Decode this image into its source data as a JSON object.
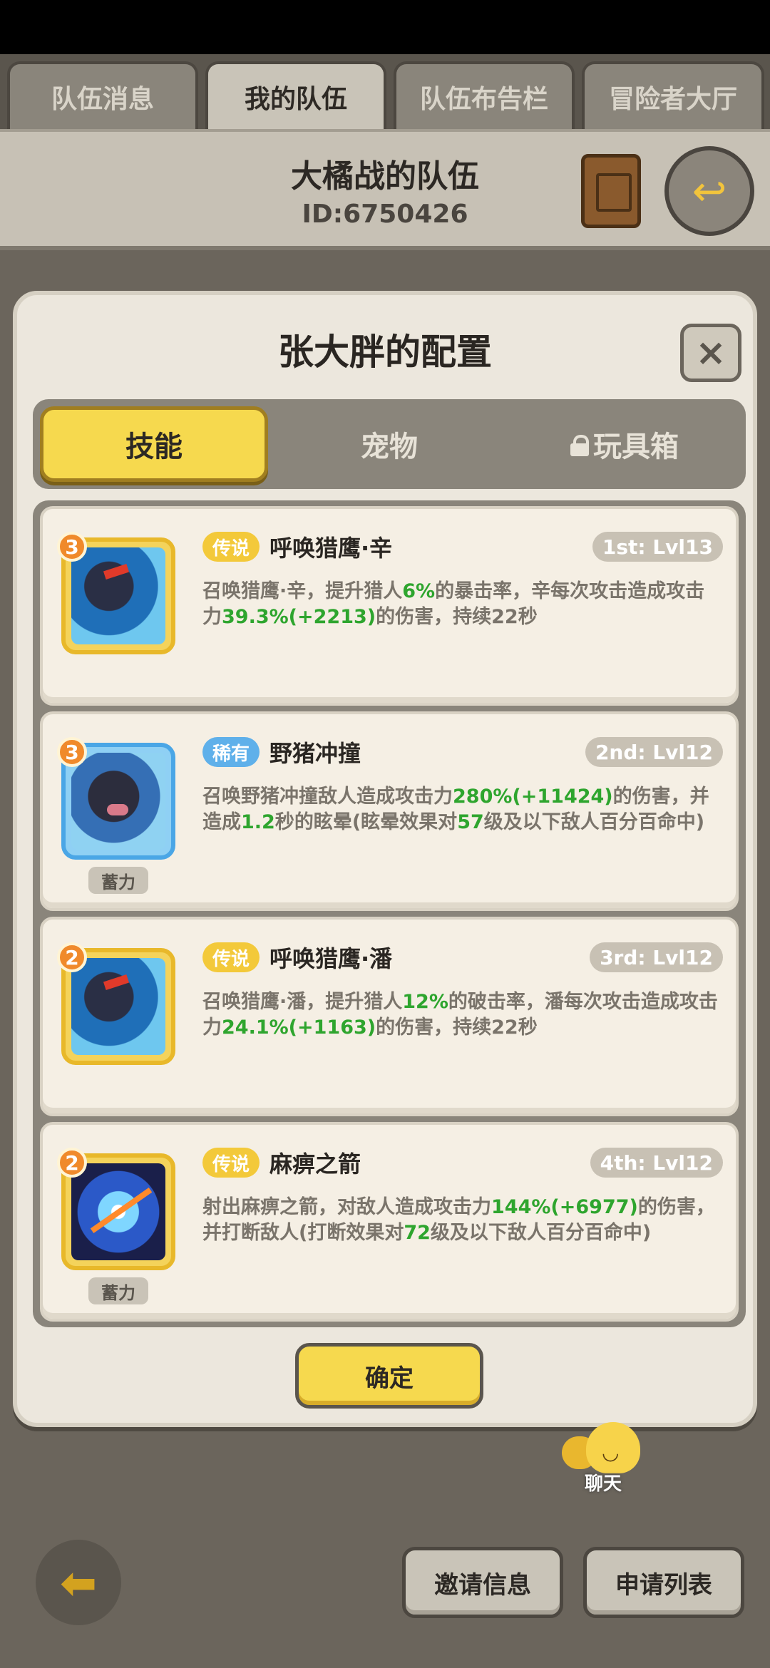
{
  "top_tabs": [
    {
      "label": "队伍消息"
    },
    {
      "label": "我的队伍"
    },
    {
      "label": "队伍布告栏"
    },
    {
      "label": "冒险者大厅"
    }
  ],
  "team": {
    "name": "大橘战的队伍",
    "id": "ID:6750426"
  },
  "modal": {
    "title": "张大胖的配置",
    "close": "×",
    "segments": [
      {
        "label": "技能"
      },
      {
        "label": "宠物"
      },
      {
        "label": "玩具箱"
      }
    ],
    "skills": [
      {
        "level": "3",
        "rarity": "传说",
        "name": "呼唤猎鹰·辛",
        "rank": "1st: Lvl13",
        "desc": [
          "召唤猎鹰·辛，提升猎人",
          "6%",
          "的暴击率，辛每次攻击造成攻击力",
          "39.3%(+2213)",
          "的伤害，持续22秒"
        ]
      },
      {
        "level": "3",
        "rarity": "稀有",
        "name": "野猪冲撞",
        "rank": "2nd: Lvl12",
        "charge": "蓄力",
        "desc": [
          "召唤野猪冲撞敌人造成攻击力",
          "280%(+11424)",
          "的伤害，并造成",
          "1.2",
          "秒的眩晕(眩晕效果对",
          "57",
          "级及以下敌人百分百命中)"
        ]
      },
      {
        "level": "2",
        "rarity": "传说",
        "name": "呼唤猎鹰·潘",
        "rank": "3rd: Lvl12",
        "desc": [
          "召唤猎鹰·潘，提升猎人",
          "12%",
          "的破击率，潘每次攻击造成攻击力",
          "24.1%(+1163)",
          "的伤害，持续22秒"
        ]
      },
      {
        "level": "2",
        "rarity": "传说",
        "name": "麻痹之箭",
        "rank": "4th: Lvl12",
        "charge": "蓄力",
        "desc": [
          "射出麻痹之箭，对敌人造成攻击力",
          "144%(+6977)",
          "的伤害，并打断敌人(打断效果对",
          "72",
          "级及以下敌人百分百命中)"
        ]
      }
    ],
    "confirm": "确定"
  },
  "chat": {
    "label": "聊天"
  },
  "bottom": {
    "invite": "邀请信息",
    "apply": "申请列表"
  },
  "colors": {
    "accent_yellow": "#f6d94e",
    "legend_badge": "#f3c93a",
    "rare_badge": "#5fb0ea",
    "value_green": "#2ea52e"
  }
}
